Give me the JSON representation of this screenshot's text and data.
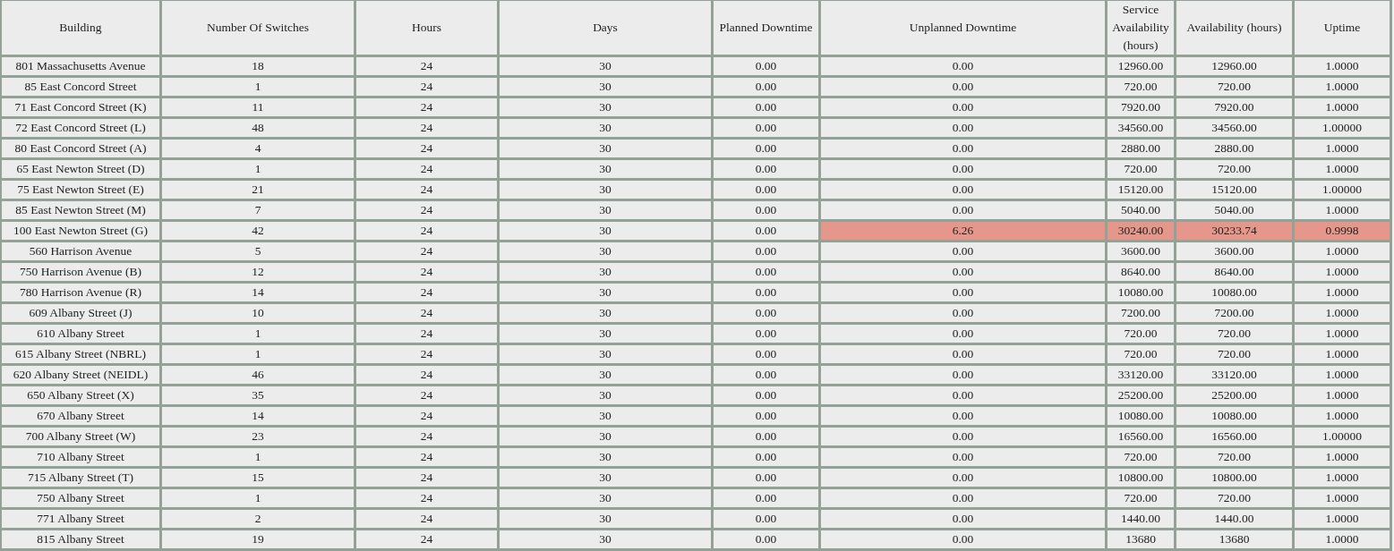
{
  "table": {
    "columns": [
      "Building",
      "Number Of Switches",
      "Hours",
      "Days",
      "Planned Downtime",
      "Unplanned Downtime",
      "Service Availability (hours)",
      "Availability (hours)",
      "Uptime"
    ],
    "rows": [
      {
        "cells": [
          "801 Massachusetts Avenue",
          "18",
          "24",
          "30",
          "0.00",
          "0.00",
          "12960.00",
          "12960.00",
          "1.0000"
        ],
        "alert": false
      },
      {
        "cells": [
          "85 East Concord Street",
          "1",
          "24",
          "30",
          "0.00",
          "0.00",
          "720.00",
          "720.00",
          "1.0000"
        ],
        "alert": false
      },
      {
        "cells": [
          "71 East Concord Street (K)",
          "11",
          "24",
          "30",
          "0.00",
          "0.00",
          "7920.00",
          "7920.00",
          "1.0000"
        ],
        "alert": false
      },
      {
        "cells": [
          "72 East Concord Street (L)",
          "48",
          "24",
          "30",
          "0.00",
          "0.00",
          "34560.00",
          "34560.00",
          "1.00000"
        ],
        "alert": false
      },
      {
        "cells": [
          "80 East Concord Street (A)",
          "4",
          "24",
          "30",
          "0.00",
          "0.00",
          "2880.00",
          "2880.00",
          "1.0000"
        ],
        "alert": false
      },
      {
        "cells": [
          "65 East Newton Street (D)",
          "1",
          "24",
          "30",
          "0.00",
          "0.00",
          "720.00",
          "720.00",
          "1.0000"
        ],
        "alert": false
      },
      {
        "cells": [
          "75 East Newton Street (E)",
          "21",
          "24",
          "30",
          "0.00",
          "0.00",
          "15120.00",
          "15120.00",
          "1.00000"
        ],
        "alert": false
      },
      {
        "cells": [
          "85 East Newton Street (M)",
          "7",
          "24",
          "30",
          "0.00",
          "0.00",
          "5040.00",
          "5040.00",
          "1.0000"
        ],
        "alert": false
      },
      {
        "cells": [
          "100 East Newton Street (G)",
          "42",
          "24",
          "30",
          "0.00",
          "6.26",
          "30240.00",
          "30233.74",
          "0.9998"
        ],
        "alert": true
      },
      {
        "cells": [
          "560 Harrison Avenue",
          "5",
          "24",
          "30",
          "0.00",
          "0.00",
          "3600.00",
          "3600.00",
          "1.0000"
        ],
        "alert": false
      },
      {
        "cells": [
          "750 Harrison Avenue (B)",
          "12",
          "24",
          "30",
          "0.00",
          "0.00",
          "8640.00",
          "8640.00",
          "1.0000"
        ],
        "alert": false
      },
      {
        "cells": [
          "780 Harrison Avenue (R)",
          "14",
          "24",
          "30",
          "0.00",
          "0.00",
          "10080.00",
          "10080.00",
          "1.0000"
        ],
        "alert": false
      },
      {
        "cells": [
          "609 Albany Street (J)",
          "10",
          "24",
          "30",
          "0.00",
          "0.00",
          "7200.00",
          "7200.00",
          "1.0000"
        ],
        "alert": false
      },
      {
        "cells": [
          "610 Albany Street",
          "1",
          "24",
          "30",
          "0.00",
          "0.00",
          "720.00",
          "720.00",
          "1.0000"
        ],
        "alert": false
      },
      {
        "cells": [
          "615 Albany Street (NBRL)",
          "1",
          "24",
          "30",
          "0.00",
          "0.00",
          "720.00",
          "720.00",
          "1.0000"
        ],
        "alert": false
      },
      {
        "cells": [
          "620 Albany Street (NEIDL)",
          "46",
          "24",
          "30",
          "0.00",
          "0.00",
          "33120.00",
          "33120.00",
          "1.0000"
        ],
        "alert": false
      },
      {
        "cells": [
          "650 Albany Street (X)",
          "35",
          "24",
          "30",
          "0.00",
          "0.00",
          "25200.00",
          "25200.00",
          "1.0000"
        ],
        "alert": false
      },
      {
        "cells": [
          "670 Albany Street",
          "14",
          "24",
          "30",
          "0.00",
          "0.00",
          "10080.00",
          "10080.00",
          "1.0000"
        ],
        "alert": false
      },
      {
        "cells": [
          "700 Albany Street (W)",
          "23",
          "24",
          "30",
          "0.00",
          "0.00",
          "16560.00",
          "16560.00",
          "1.00000"
        ],
        "alert": false
      },
      {
        "cells": [
          "710 Albany Street",
          "1",
          "24",
          "30",
          "0.00",
          "0.00",
          "720.00",
          "720.00",
          "1.0000"
        ],
        "alert": false
      },
      {
        "cells": [
          "715 Albany Street (T)",
          "15",
          "24",
          "30",
          "0.00",
          "0.00",
          "10800.00",
          "10800.00",
          "1.0000"
        ],
        "alert": false
      },
      {
        "cells": [
          "750 Albany Street",
          "1",
          "24",
          "30",
          "0.00",
          "0.00",
          "720.00",
          "720.00",
          "1.0000"
        ],
        "alert": false
      },
      {
        "cells": [
          "771 Albany Street",
          "2",
          "24",
          "30",
          "0.00",
          "0.00",
          "1440.00",
          "1440.00",
          "1.0000"
        ],
        "alert": false
      },
      {
        "cells": [
          "815 Albany Street",
          "19",
          "24",
          "30",
          "0.00",
          "0.00",
          "13680",
          "13680",
          "1.0000"
        ],
        "alert": false
      }
    ]
  }
}
